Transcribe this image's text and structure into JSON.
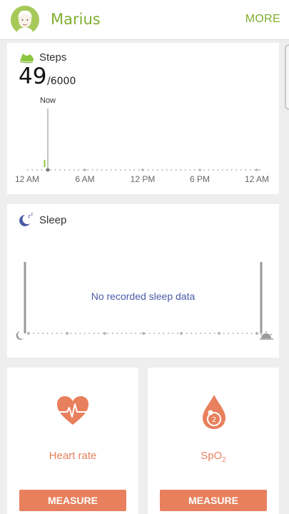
{
  "header": {
    "user_name": "Marius",
    "more_label": "MORE"
  },
  "steps": {
    "title": "Steps",
    "count": "49",
    "goal": "/6000",
    "now_label": "Now",
    "axis_labels": [
      "12 AM",
      "6 AM",
      "12 PM",
      "6 PM",
      "12 AM"
    ]
  },
  "sleep": {
    "title": "Sleep",
    "empty_message": "No recorded sleep data"
  },
  "heart_rate": {
    "label": "Heart rate",
    "button": "MEASURE"
  },
  "spo2": {
    "label_main": "SpO",
    "label_sub": "2",
    "button": "MEASURE",
    "icon_digit": "2"
  },
  "colors": {
    "accent_green": "#7fae2e",
    "accent_orange": "#e8805d",
    "sleep_blue": "#4a5aa8"
  }
}
